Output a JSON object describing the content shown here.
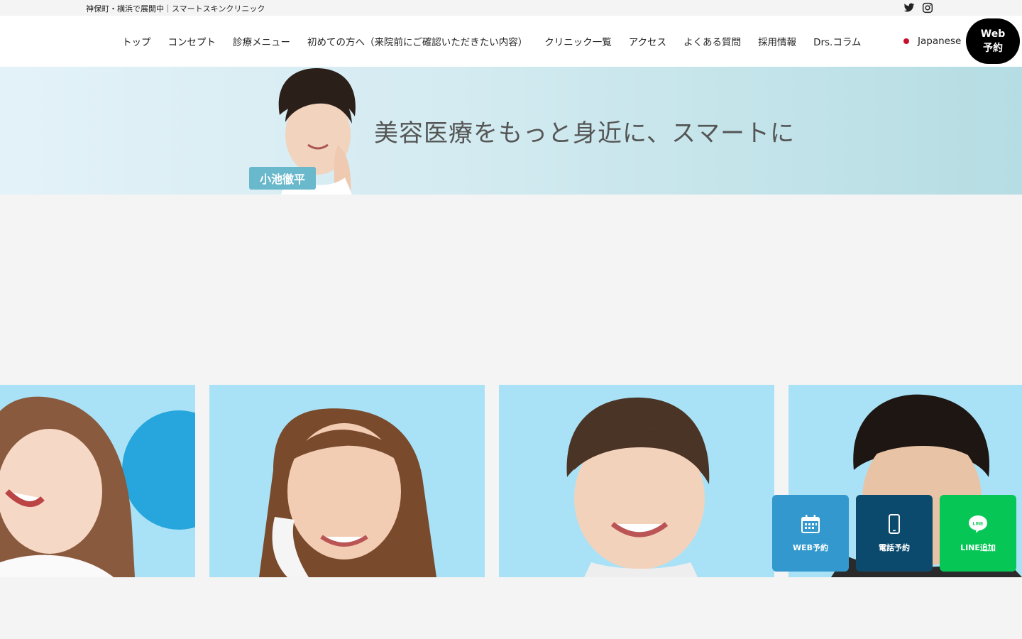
{
  "topbar": {
    "tagline": "神保町・横浜で展開中｜スマートスキンクリニック"
  },
  "social": {
    "twitter_icon": "twitter-icon",
    "instagram_icon": "instagram-icon"
  },
  "nav": {
    "items": [
      {
        "label": "トップ"
      },
      {
        "label": "コンセプト"
      },
      {
        "label": "診療メニュー"
      },
      {
        "label": "初めての方へ（来院前にご確認いただきたい内容）"
      },
      {
        "label": "クリニック一覧"
      },
      {
        "label": "アクセス"
      },
      {
        "label": "よくある質問"
      },
      {
        "label": "採用情報"
      },
      {
        "label": "Drs.コラム"
      }
    ],
    "language": "Japanese"
  },
  "web_reserve": {
    "line1": "Web",
    "line2": "予約"
  },
  "banner": {
    "name": "小池徹平",
    "tagline": "美容医療をもっと身近に、スマートに"
  },
  "fabs": {
    "web": {
      "label": "WEB予約",
      "icon": "calendar-icon"
    },
    "tel": {
      "label": "電話予約",
      "icon": "smartphone-icon"
    },
    "line": {
      "label": "LINE追加",
      "icon": "line-icon",
      "icon_text": "LINE"
    }
  },
  "colors": {
    "fab_web": "#3398cd",
    "fab_tel": "#0b4a6d",
    "fab_line": "#06c755",
    "photo_bg": "#a9e2f6",
    "lang_dot": "#c8102e"
  }
}
